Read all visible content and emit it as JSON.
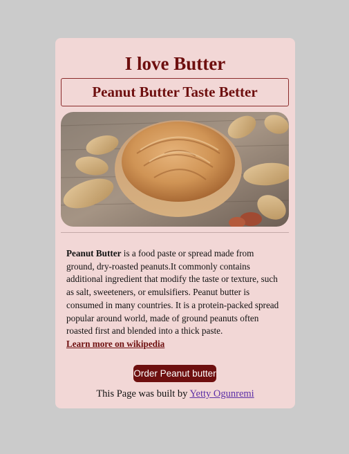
{
  "page": {
    "title": "I love Butter",
    "subtitle": "Peanut Butter Taste Better"
  },
  "hero_image": {
    "alt": "Bowl of peanut butter surrounded by peanuts",
    "icon": "peanut-butter-bowl-image"
  },
  "description": {
    "bold_term": "Peanut Butter",
    "text": " is a food paste or spread made from ground, dry-roasted peanuts.It commonly contains additional ingredient that modify the taste or texture, such as salt, sweeteners, or emulsifiers. Peanut butter is consumed in many countries. It is a protein-packed spread popular around world, made of ground peanuts often roasted first and blended into a thick paste.",
    "link_label": "Learn more on wikipedia"
  },
  "actions": {
    "order_label": "Order Peanut butter"
  },
  "footer": {
    "prefix": "This Page was built by ",
    "author_link": "Yetty Ogunremi"
  },
  "colors": {
    "background": "#cbcbcb",
    "card": "#f2d7d6",
    "accent": "#6e0f0f",
    "link": "#5b2ea6"
  }
}
